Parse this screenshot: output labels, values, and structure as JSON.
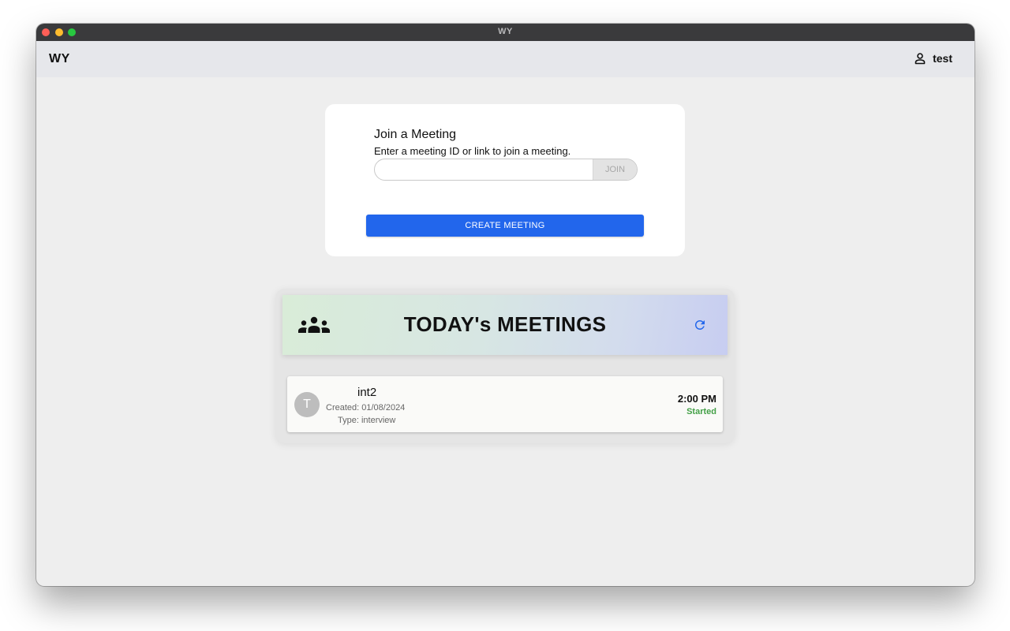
{
  "window": {
    "title": "WY"
  },
  "appbar": {
    "brand": "WY",
    "user": {
      "name": "test",
      "icon": "person-icon"
    }
  },
  "join": {
    "title": "Join a Meeting",
    "subtitle": "Enter a meeting ID or link to join a meeting.",
    "input_value": "",
    "input_placeholder": "",
    "join_label": "JOIN",
    "create_label": "CREATE MEETING"
  },
  "meetings": {
    "title": "TODAY's MEETINGS",
    "header_icon": "group-icon",
    "refresh_icon": "refresh-icon",
    "items": [
      {
        "avatar_initial": "T",
        "name": "int2",
        "created": "Created: 01/08/2024",
        "type": "Type: interview",
        "time": "2:00 PM",
        "status": "Started"
      }
    ]
  },
  "colors": {
    "primary": "#2266ec",
    "status_started": "#43a047",
    "refresh_icon": "#2266ec"
  }
}
